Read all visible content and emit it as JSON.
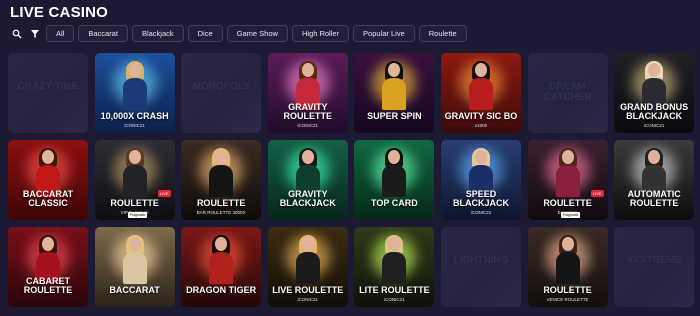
{
  "page": {
    "title": "LIVE CASINO"
  },
  "filters": {
    "search_icon": "search-icon",
    "filter_icon": "filter-icon",
    "chips": [
      "All",
      "Baccarat",
      "Blackjack",
      "Dice",
      "Game Show",
      "High Roller",
      "Popular Live",
      "Roulette"
    ]
  },
  "colors": {
    "background": "#1c1a33",
    "chip_border": "#3f3c5e",
    "chip_bg": "#201e39"
  },
  "games": [
    {
      "name": "",
      "sub": "",
      "placeholder": true,
      "ghost": "CRAZY TIME"
    },
    {
      "name": "10,000X CRASH",
      "sub": "iCONIC21",
      "placeholder": false,
      "bg": [
        "#1d4f9a",
        "#0c1f49"
      ],
      "glow": "#69d0ff",
      "hair": "#d7b36a",
      "body": "#1b3a78"
    },
    {
      "name": "",
      "sub": "",
      "placeholder": true,
      "ghost": "MONOPOLY"
    },
    {
      "name": "GRAVITY ROULETTE",
      "sub": "iCONIC21",
      "placeholder": false,
      "bg": [
        "#5c1d58",
        "#1f0b2b"
      ],
      "glow": "#ff8bd4",
      "hair": "#5a2a1c",
      "body": "#c8283b"
    },
    {
      "name": "SUPER SPIN",
      "sub": "",
      "placeholder": false,
      "bg": [
        "#3a0f3c",
        "#150822"
      ],
      "glow": "#ffcb3a",
      "hair": "#111111",
      "body": "#d9a120"
    },
    {
      "name": "GRAVITY SIC BO",
      "sub": "x1000",
      "placeholder": false,
      "bg": [
        "#8d1a12",
        "#3b0a0a"
      ],
      "glow": "#ff9b3a",
      "hair": "#1a1010",
      "body": "#b81d1d"
    },
    {
      "name": "",
      "sub": "",
      "placeholder": true,
      "ghost": "DREAM CATCHER"
    },
    {
      "name": "GRAND BONUS BLACKJACK",
      "sub": "iCONIC21",
      "placeholder": false,
      "bg": [
        "#1f1f26",
        "#0b0b10"
      ],
      "glow": "#d9c27a",
      "hair": "#e8d6b8",
      "body": "#2b2b31"
    },
    {
      "name": "BACCARAT CLASSIC",
      "sub": "",
      "placeholder": false,
      "bg": [
        "#8c1010",
        "#3e0505"
      ],
      "glow": "#ff5252",
      "hair": "#3b1a0c",
      "body": "#c01717"
    },
    {
      "name": "Roulette",
      "sub": "VIP European",
      "placeholder": false,
      "badge": "LIVE",
      "ptag": "Pragmatic",
      "bg": [
        "#2c2c33",
        "#0e0e12"
      ],
      "glow": "#c8a36b",
      "hair": "#5a3a22",
      "body": "#222228"
    },
    {
      "name": "ROULETTE",
      "sub": "BAR ROULETTE 3000X",
      "placeholder": false,
      "bg": [
        "#3a2a22",
        "#100b0a"
      ],
      "glow": "#ffc27a",
      "hair": "#e0b779",
      "body": "#141414"
    },
    {
      "name": "GRAVITY BLACKJACK",
      "sub": "",
      "placeholder": false,
      "bg": [
        "#16604a",
        "#07241c"
      ],
      "glow": "#3cffb6",
      "hair": "#1a1a1a",
      "body": "#0f3d30"
    },
    {
      "name": "TOP CARD",
      "sub": "",
      "placeholder": false,
      "bg": [
        "#0f6a42",
        "#052817"
      ],
      "glow": "#6affb0",
      "hair": "#111111",
      "body": "#1b1b1b"
    },
    {
      "name": "SPEED BLACKJACK",
      "sub": "iCONIC21",
      "placeholder": false,
      "bg": [
        "#2a3f74",
        "#0d152d"
      ],
      "glow": "#5eb6ff",
      "hair": "#e8c89a",
      "body": "#1b2f66"
    },
    {
      "name": "Roulette",
      "sub": "European",
      "placeholder": false,
      "badge": "LIVE",
      "ptag": "Pragmatic",
      "bg": [
        "#3a2030",
        "#110a10"
      ],
      "glow": "#ff7aa8",
      "hair": "#4a2a1c",
      "body": "#8a1f3b"
    },
    {
      "name": "AUTOMATIC ROULETTE",
      "sub": "",
      "placeholder": false,
      "bg": [
        "#3b3b3b",
        "#0d0d0d"
      ],
      "glow": "#dddddd",
      "hair": "#222222",
      "body": "#333333"
    },
    {
      "name": "CABARET ROULETTE",
      "sub": "",
      "placeholder": false,
      "bg": [
        "#7a0f1a",
        "#2a0508"
      ],
      "glow": "#ff4a5e",
      "hair": "#3a1410",
      "body": "#a3121e"
    },
    {
      "name": "BACCARAT",
      "sub": "",
      "placeholder": false,
      "bg": [
        "#7d6a4a",
        "#2c2318"
      ],
      "glow": "#ffe2a8",
      "hair": "#e6c27a",
      "body": "#d9c7a3"
    },
    {
      "name": "DRAGON TIGER",
      "sub": "",
      "placeholder": false,
      "bg": [
        "#7a1818",
        "#230707"
      ],
      "glow": "#ff5a3a",
      "hair": "#1a0d0d",
      "body": "#b0201c"
    },
    {
      "name": "LIVE ROULETTE",
      "sub": "iCONIC21",
      "placeholder": false,
      "bg": [
        "#3b2b12",
        "#120c05"
      ],
      "glow": "#ffc35a",
      "hair": "#e3b56b",
      "body": "#1b1b1b"
    },
    {
      "name": "Lite ROULETTE",
      "sub": "iCONIC21",
      "placeholder": false,
      "bg": [
        "#2f3a1a",
        "#0e1207"
      ],
      "glow": "#c7ff5a",
      "hair": "#e0c08a",
      "body": "#202020"
    },
    {
      "name": "",
      "sub": "",
      "placeholder": true,
      "ghost": "LIGHTNING"
    },
    {
      "name": "ROULETTE",
      "sub": "VENICE ROULETTE",
      "placeholder": false,
      "bg": [
        "#3a2a25",
        "#120d0b"
      ],
      "glow": "#ffbf9a",
      "hair": "#3b2518",
      "body": "#151515"
    },
    {
      "name": "",
      "sub": "",
      "placeholder": true,
      "ghost": "XXXTREME"
    }
  ]
}
